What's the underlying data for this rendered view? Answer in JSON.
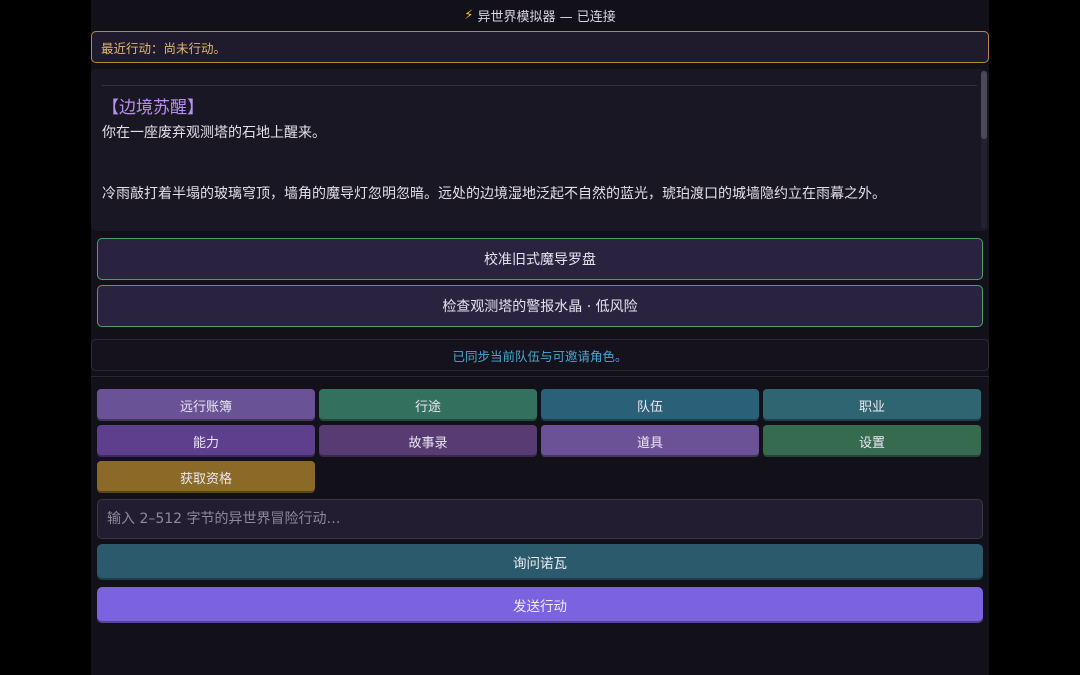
{
  "header": {
    "icon": "lightning-bolt-icon",
    "title": "异世界模拟器 — 已连接"
  },
  "recent_action": "最近行动：尚未行动。",
  "story": {
    "title": "【边境苏醒】",
    "paragraphs": [
      "你在一座废弃观测塔的石地上醒来。",
      "冷雨敲打着半塌的玻璃穹顶，墙角的魔导灯忽明忽暗。远处的边境湿地泛起不自然的蓝光，琥珀渡口的城墙隐约立在雨幕之外。"
    ]
  },
  "choices": [
    "校准旧式魔导罗盘",
    "检查观测塔的警报水晶 · 低风险"
  ],
  "sync_status": "已同步当前队伍与可邀请角色。",
  "nav": [
    {
      "label": "远行账簿",
      "color": "#6a5296"
    },
    {
      "label": "行途",
      "color": "#34705e"
    },
    {
      "label": "队伍",
      "color": "#2a6178"
    },
    {
      "label": "职业",
      "color": "#2f6570"
    },
    {
      "label": "能力",
      "color": "#5e3f8e"
    },
    {
      "label": "故事录",
      "color": "#583b72"
    },
    {
      "label": "道具",
      "color": "#6b5296"
    },
    {
      "label": "设置",
      "color": "#376b50"
    },
    {
      "label": "获取资格",
      "color": "#8a6a26"
    }
  ],
  "input": {
    "placeholder": "输入 2–512 字节的异世界冒险行动…",
    "value": ""
  },
  "ask_button": "询问诺瓦",
  "send_button": "发送行动"
}
